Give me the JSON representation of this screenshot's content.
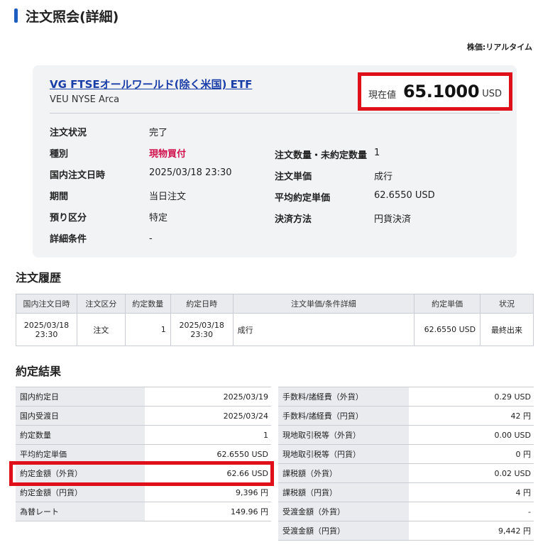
{
  "header": {
    "title": "注文照会(詳細)",
    "price_mode": "株価:リアルタイム"
  },
  "fund": {
    "name": "VG FTSEオールワールド(除く米国) ETF",
    "ticker_market": "VEU NYSE Arca",
    "price_label": "現在値",
    "price_value": "65.1000",
    "price_unit": "USD"
  },
  "details_left": [
    {
      "label": "注文状況",
      "value": "完了"
    },
    {
      "label": "種別",
      "value": "現物買付"
    },
    {
      "label": "国内注文日時",
      "value": "2025/03/18 23:30"
    },
    {
      "label": "期間",
      "value": "当日注文"
    },
    {
      "label": "預り区分",
      "value": "特定"
    },
    {
      "label": "詳細条件",
      "value": "-"
    }
  ],
  "details_right": [
    {
      "label": "注文数量・未約定数量",
      "value": "1"
    },
    {
      "label": "注文単価",
      "value": "成行"
    },
    {
      "label": "平均約定単価",
      "value": "62.6550 USD"
    },
    {
      "label": "決済方法",
      "value": "円貨決済"
    }
  ],
  "history": {
    "title": "注文履歴",
    "columns": [
      "国内注文日時",
      "注文区分",
      "約定数量",
      "約定日時",
      "注文単価/条件詳細",
      "約定単価",
      "状況"
    ],
    "row": {
      "order_date": "2025/03/18",
      "order_time": "23:30",
      "type": "注文",
      "qty": "1",
      "exec_date": "2025/03/18",
      "exec_time": "23:30",
      "condition": "成行",
      "price": "62.6550 USD",
      "status": "最終出来"
    }
  },
  "result": {
    "title": "約定結果",
    "left": [
      {
        "label": "国内約定日",
        "value": "2025/03/19"
      },
      {
        "label": "国内受渡日",
        "value": "2025/03/24"
      },
      {
        "label": "約定数量",
        "value": "1"
      },
      {
        "label": "平均約定単価",
        "value": "62.6550 USD"
      },
      {
        "label": "約定金額（外貨）",
        "value": "62.66 USD"
      },
      {
        "label": "約定金額（円貨）",
        "value": "9,396 円"
      },
      {
        "label": "為替レート",
        "value": "149.96 円"
      }
    ],
    "right": [
      {
        "label": "手数料/諸経費（外貨）",
        "value": "0.29 USD"
      },
      {
        "label": "手数料/諸経費（円貨）",
        "value": "42 円"
      },
      {
        "label": "現地取引税等（外貨）",
        "value": "0.00 USD"
      },
      {
        "label": "現地取引税等（円貨）",
        "value": "0 円"
      },
      {
        "label": "課税額（外貨）",
        "value": "0.02 USD"
      },
      {
        "label": "課税額（円貨）",
        "value": "4 円"
      },
      {
        "label": "受渡金額（外貨）",
        "value": "-"
      },
      {
        "label": "受渡金額（円貨）",
        "value": "9,442 円"
      }
    ]
  },
  "colors": {
    "accent": "#1d5fc1",
    "highlight": "#e0101b",
    "buy": "#d0104c",
    "link": "#1a3ea8"
  }
}
